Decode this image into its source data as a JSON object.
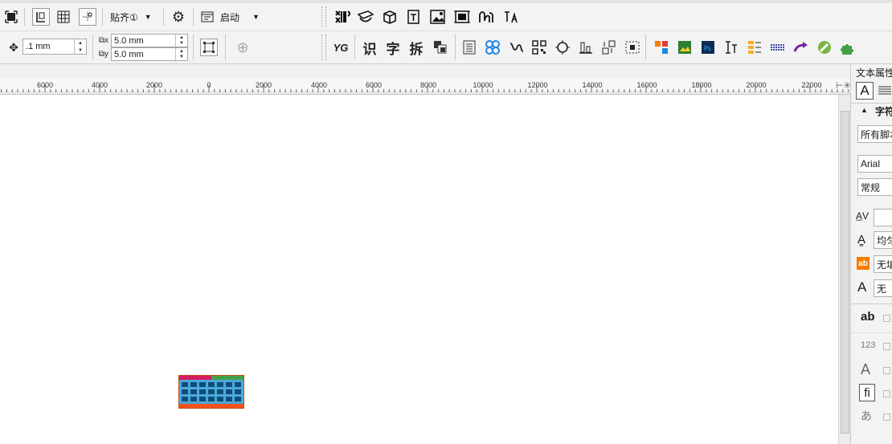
{
  "toolbar_top": {
    "snap_label": "贴齐①",
    "launch_label": "启动",
    "icon_names": [
      "select-frame-icon",
      "page-layout-icon",
      "grid-icon",
      "guideline-icon",
      "snap-dropdown-icon",
      "settings-gear-icon",
      "launch-window-icon",
      "barcode-icon",
      "film-icon",
      "box-3d-icon",
      "text-frame-icon",
      "image-trace-icon",
      "crop-icon",
      "wave-icon",
      "mono-fa-icon"
    ]
  },
  "toolbar_second": {
    "nudge_value": ".1 mm",
    "dup_x": "5.0 mm",
    "dup_y": "5.0 mm",
    "yg_label": "YG",
    "chars": [
      "识",
      "字",
      "拆"
    ]
  },
  "ruler": {
    "labels": [
      "6000",
      "4000",
      "2000",
      "0",
      "2000",
      "4000",
      "6000",
      "8000",
      "10000",
      "12000",
      "14000",
      "16000",
      "18000",
      "20000",
      "22000"
    ]
  },
  "panel": {
    "title": "文本属性",
    "section": "字符",
    "script": "所有脚本",
    "font": "Arial",
    "style": "常规",
    "underline": "均匀",
    "fill": "无填",
    "outline": "无",
    "sample_123": "123"
  },
  "colors": {
    "accent_blue": "#2ea1d4",
    "canvas": "#ffffff"
  }
}
